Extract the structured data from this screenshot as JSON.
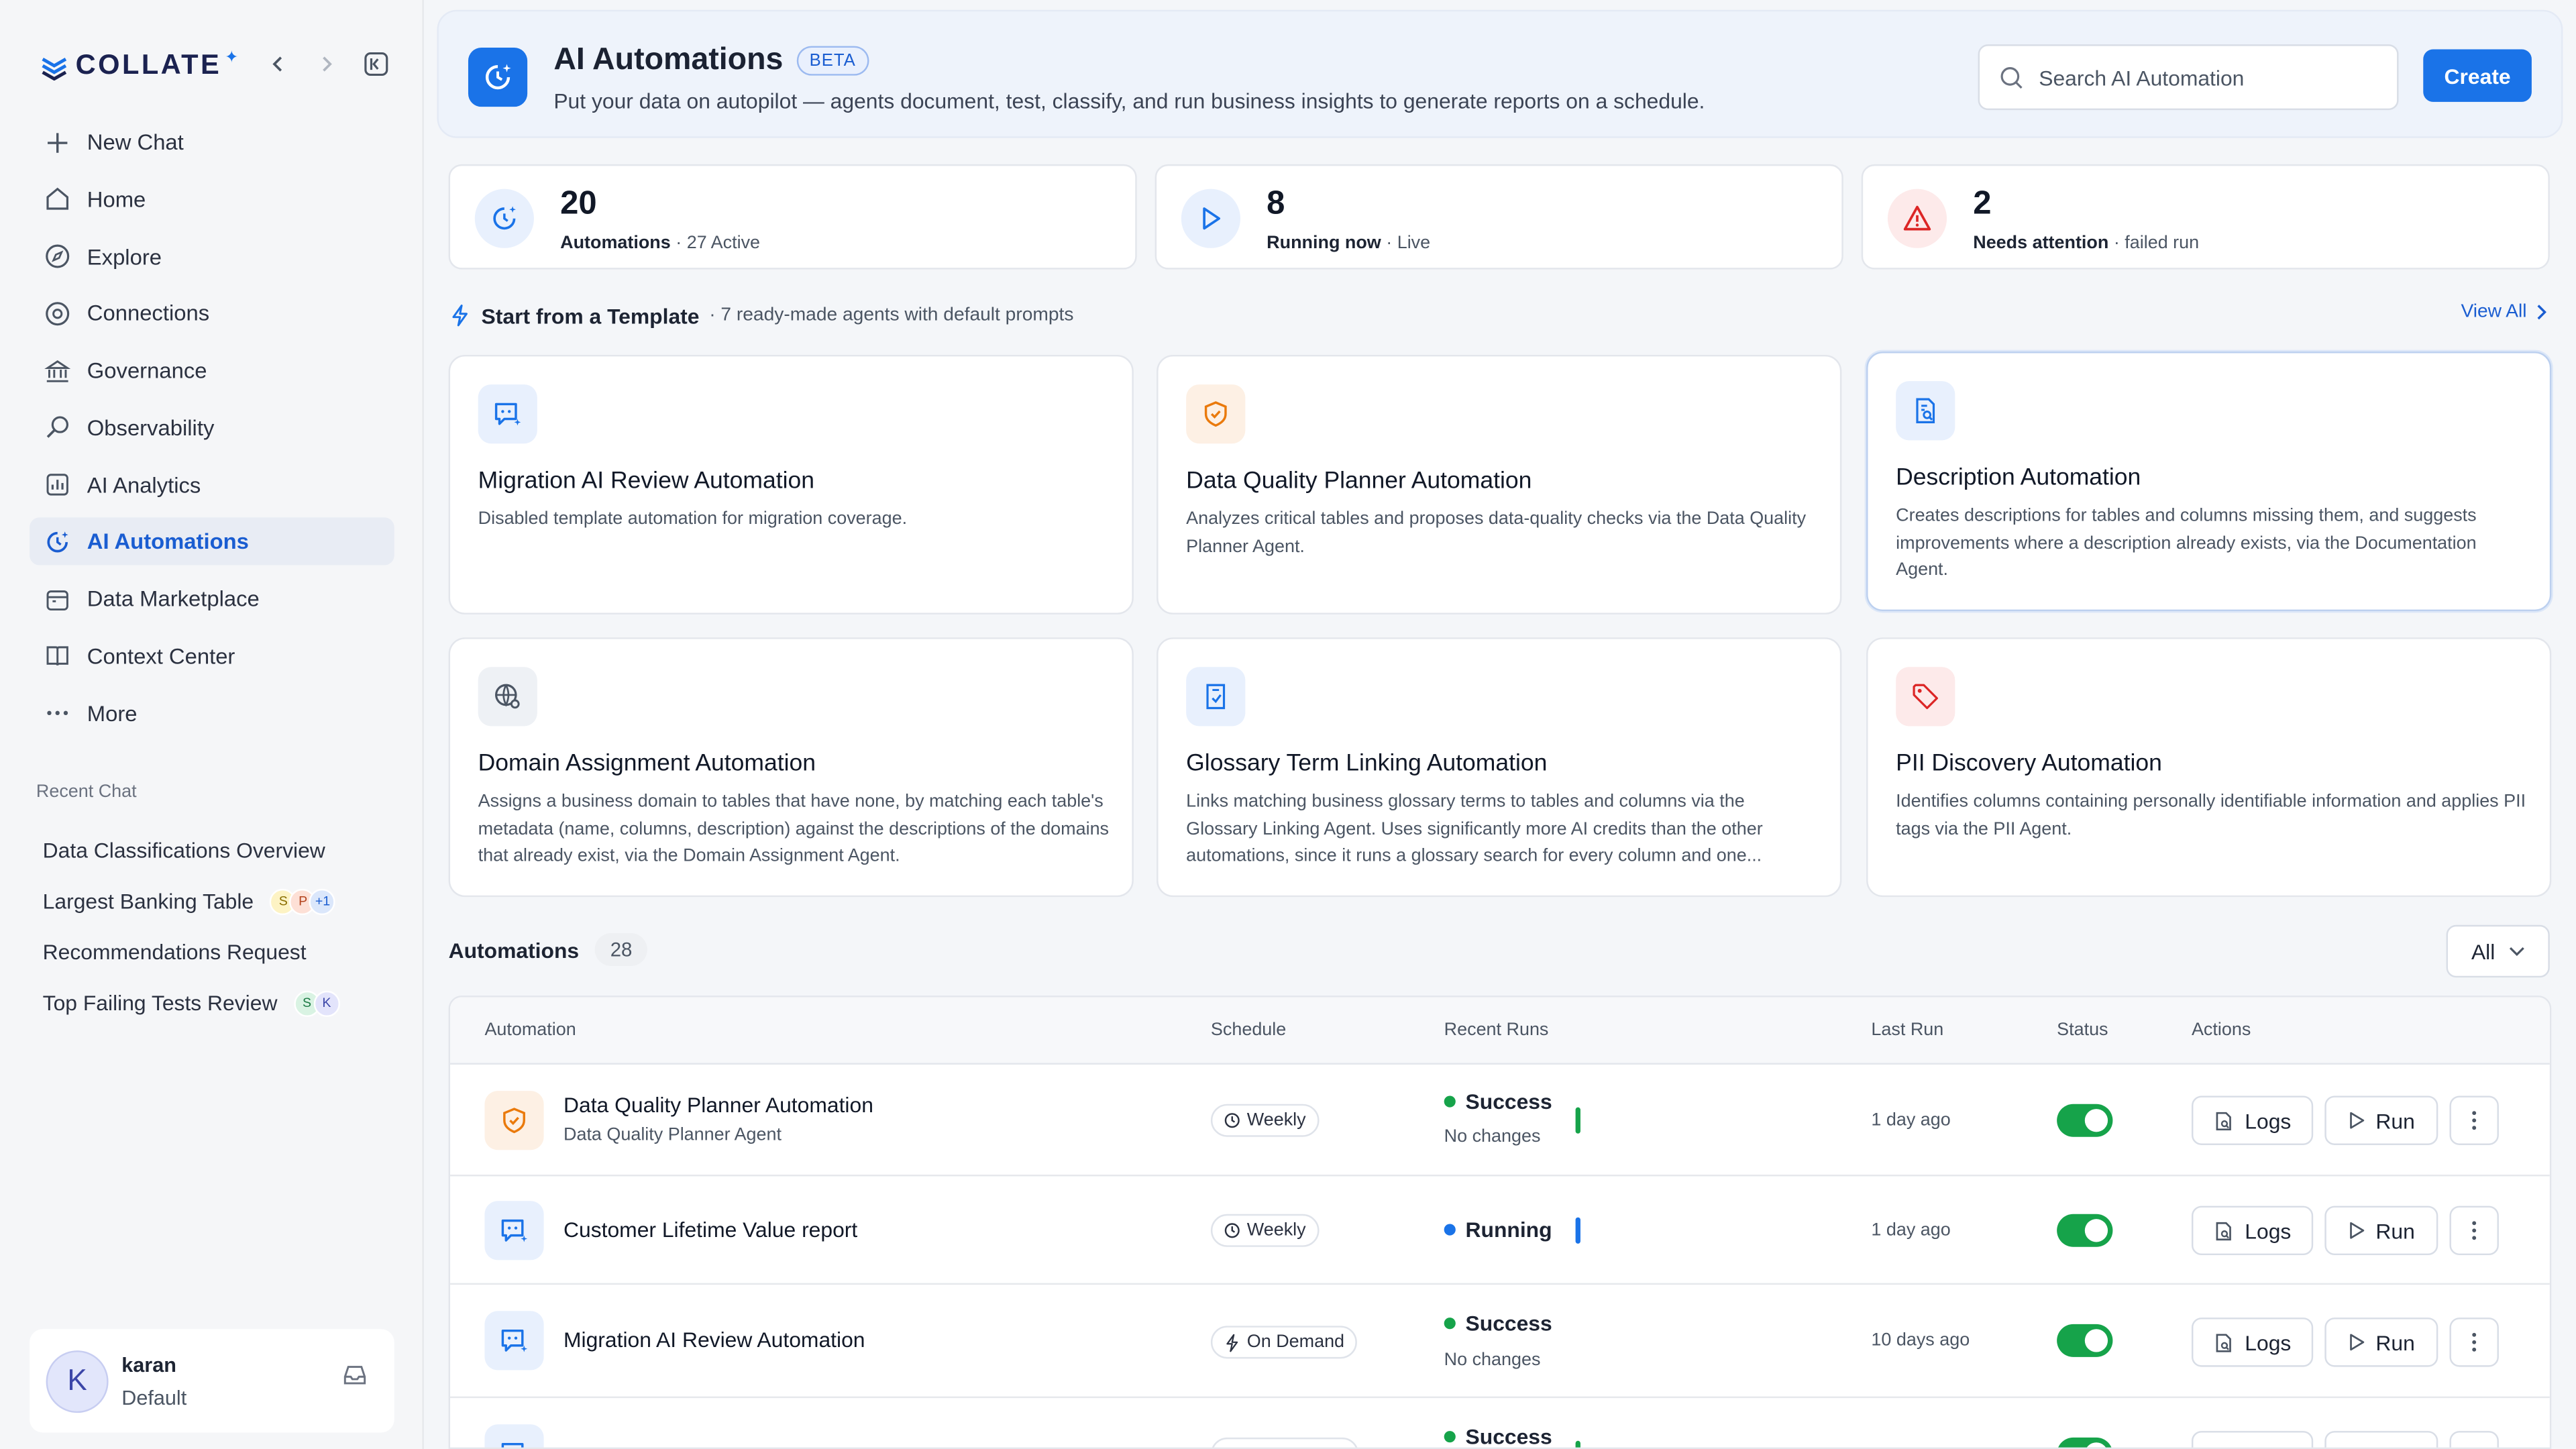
{
  "brand": {
    "name": "COLLATE",
    "sup": "✦"
  },
  "sidebar": {
    "items": [
      {
        "label": "New Chat"
      },
      {
        "label": "Home"
      },
      {
        "label": "Explore"
      },
      {
        "label": "Connections"
      },
      {
        "label": "Governance"
      },
      {
        "label": "Observability"
      },
      {
        "label": "AI Analytics"
      },
      {
        "label": "AI Automations"
      },
      {
        "label": "Data Marketplace"
      },
      {
        "label": "Context Center"
      },
      {
        "label": "More"
      }
    ],
    "recent_title": "Recent Chat",
    "recent": [
      {
        "label": "Data Classifications Overview"
      },
      {
        "label": "Largest Banking Table",
        "avatars": [
          "S",
          "P",
          "+1"
        ]
      },
      {
        "label": "Recommendations Request"
      },
      {
        "label": "Top Failing Tests Review",
        "avatars": [
          "S",
          "K"
        ]
      }
    ],
    "user": {
      "initial": "K",
      "name": "karan",
      "role": "Default"
    }
  },
  "header": {
    "title": "AI Automations",
    "badge": "BETA",
    "subtitle": "Put your data on autopilot — agents document, test, classify, and run business insights to generate reports on a schedule.",
    "search_placeholder": "Search AI Automation",
    "create_label": "Create"
  },
  "stats": [
    {
      "value": "20",
      "label": "Automations",
      "note": " · 27 Active"
    },
    {
      "value": "8",
      "label": "Running now",
      "note": " · Live"
    },
    {
      "value": "2",
      "label": "Needs attention",
      "note": " · failed run"
    }
  ],
  "templates": {
    "title": "Start from a Template",
    "subtitle": "· 7 ready-made agents with default prompts",
    "view_all": "View All",
    "cards": [
      {
        "title": "Migration AI Review Automation",
        "desc": "Disabled template automation for migration coverage."
      },
      {
        "title": "Data Quality Planner Automation",
        "desc": "Analyzes critical tables and proposes data-quality checks via the Data Quality Planner Agent."
      },
      {
        "title": "Description Automation",
        "desc": "Creates descriptions for tables and columns missing them, and suggests improvements where a description already exists, via the Documentation Agent."
      },
      {
        "title": "Domain Assignment Automation",
        "desc": "Assigns a business domain to tables that have none, by matching each table's metadata (name, columns, description) against the descriptions of the domains that already exist, via the Domain Assignment Agent."
      },
      {
        "title": "Glossary Term Linking Automation",
        "desc": "Links matching business glossary terms to tables and columns via the Glossary Linking Agent. Uses significantly more AI credits than the other automations, since it runs a glossary search for every column and one..."
      },
      {
        "title": "PII Discovery Automation",
        "desc": "Identifies columns containing personally identifiable information and applies PII tags via the PII Agent."
      }
    ]
  },
  "automations": {
    "title": "Automations",
    "count": "28",
    "filter": "All",
    "columns": [
      "Automation",
      "Schedule",
      "Recent Runs",
      "Last Run",
      "Status",
      "Actions"
    ],
    "logs_label": "Logs",
    "run_label": "Run",
    "rows": [
      {
        "name": "Data Quality Planner Automation",
        "agent": "Data Quality Planner Agent",
        "schedule": "Weekly",
        "status": "Success",
        "status_note": "No changes",
        "last_run": "1 day ago",
        "enabled": true
      },
      {
        "name": "Customer Lifetime Value report",
        "agent": "",
        "schedule": "Weekly",
        "status": "Running",
        "status_note": "",
        "last_run": "1 day ago",
        "enabled": true
      },
      {
        "name": "Migration AI Review Automation",
        "agent": "",
        "schedule": "On Demand",
        "status": "Success",
        "status_note": "No changes",
        "last_run": "10 days ago",
        "enabled": true
      },
      {
        "name": "",
        "agent": "",
        "schedule": "",
        "status": "Success",
        "status_note": "",
        "last_run": "",
        "enabled": true
      }
    ]
  },
  "colors": {
    "accent": "#1a73e8",
    "success": "#16a34a",
    "running": "#1a73e8",
    "danger": "#dc2626",
    "warning": "#ea7a0c"
  }
}
